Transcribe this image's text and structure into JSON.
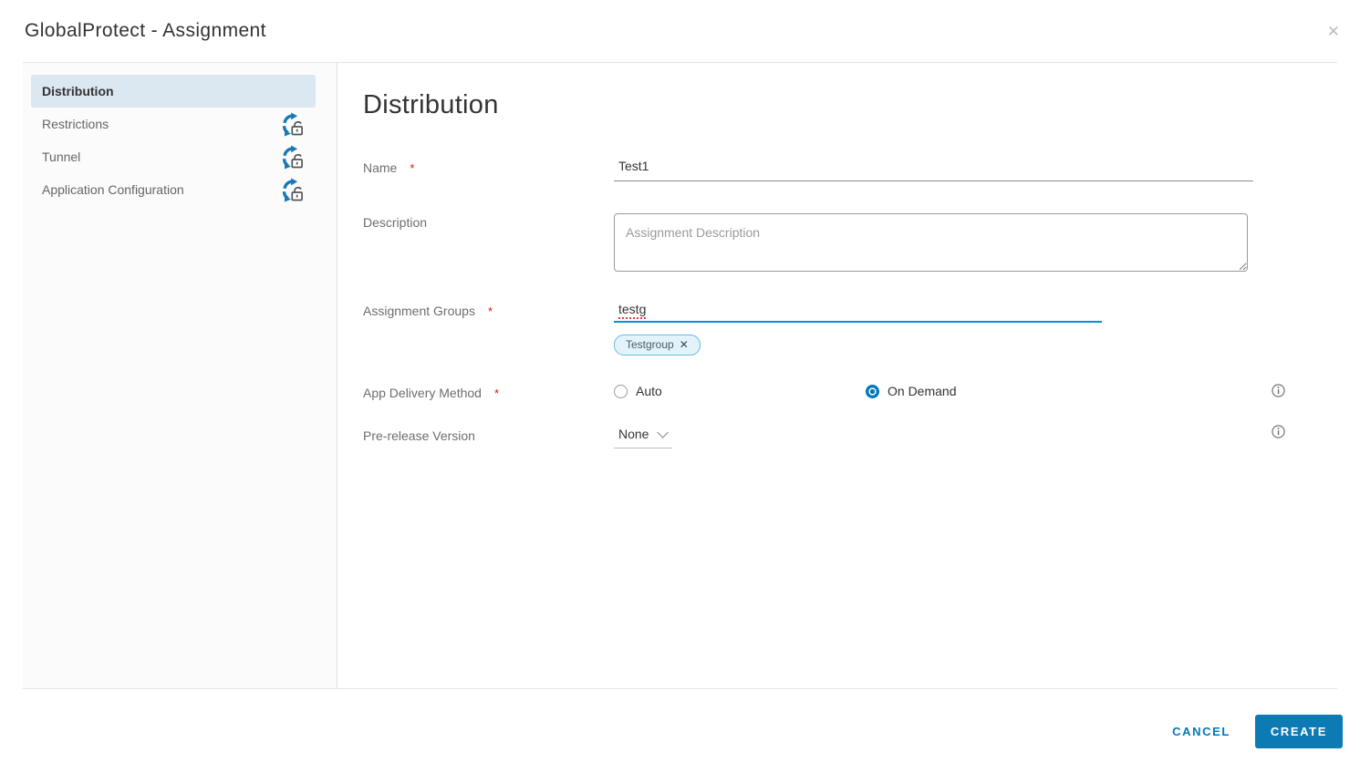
{
  "dialog": {
    "title": "GlobalProtect - Assignment",
    "close_icon": "✕"
  },
  "sidebar": {
    "items": [
      {
        "label": "Distribution",
        "selected": true,
        "locked": false
      },
      {
        "label": "Restrictions",
        "selected": false,
        "locked": true
      },
      {
        "label": "Tunnel",
        "selected": false,
        "locked": true
      },
      {
        "label": "Application Configuration",
        "selected": false,
        "locked": true
      }
    ]
  },
  "main": {
    "heading": "Distribution",
    "name": {
      "label": "Name",
      "required_marker": "*",
      "value": "Test1"
    },
    "description": {
      "label": "Description",
      "placeholder": "Assignment Description"
    },
    "assignment_groups": {
      "label": "Assignment Groups",
      "required_marker": "*",
      "typed_value": "testg",
      "chip": {
        "label": "Testgroup",
        "remove_icon": "✕"
      }
    },
    "app_delivery_method": {
      "label": "App Delivery Method",
      "required_marker": "*",
      "options": [
        {
          "label": "Auto",
          "selected": false
        },
        {
          "label": "On Demand",
          "selected": true
        }
      ]
    },
    "pre_release_version": {
      "label": "Pre-release Version",
      "value": "None"
    }
  },
  "footer": {
    "cancel_label": "CANCEL",
    "create_label": "CREATE"
  },
  "colors": {
    "accent_blue": "#0079b8",
    "create_button_bg": "#0c7bb3",
    "focus_underline": "#0095d3",
    "selected_nav_bg": "#dbe7f1",
    "chip_bg": "#e3f3fc",
    "chip_border": "#6cb9e3",
    "required_red": "#c92100",
    "sync_arrow_blue": "#1779ba"
  }
}
